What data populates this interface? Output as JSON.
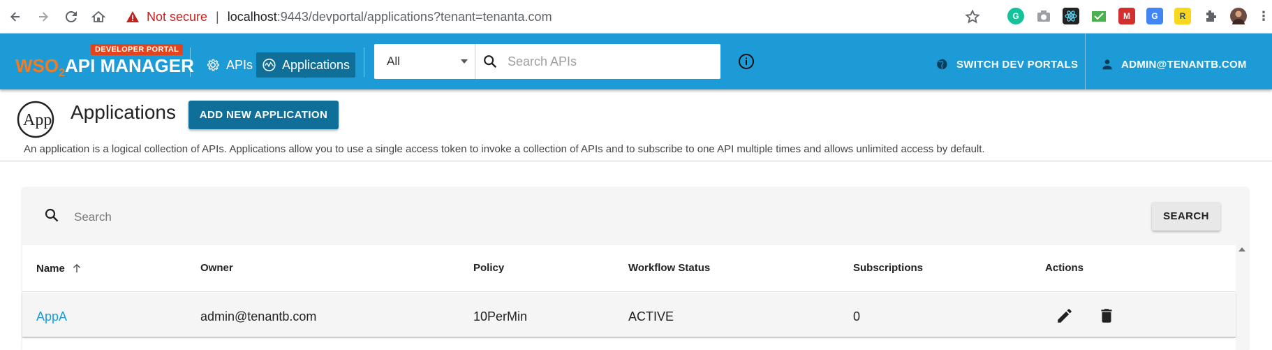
{
  "browser": {
    "security_label": "Not secure",
    "url_host": "localhost",
    "url_rest": ":9443/devportal/applications?tenant=tenanta.com"
  },
  "header": {
    "badge": "DEVELOPER PORTAL",
    "logo_wso": "WSO",
    "logo_sub": "2",
    "product": "API MANAGER",
    "nav": [
      {
        "label": "APIs",
        "icon": "gear-icon"
      },
      {
        "label": "Applications",
        "icon": "applications-icon",
        "active": true
      }
    ],
    "search": {
      "scope": "All",
      "placeholder": "Search APIs"
    },
    "switch_portals": "SWITCH DEV PORTALS",
    "user": "ADMIN@TENANTB.COM"
  },
  "page": {
    "logo_text": "App",
    "title": "Applications",
    "add_button": "ADD NEW APPLICATION",
    "description": "An application is a logical collection of APIs. Applications allow you to use a single access token to invoke a collection of APIs and to subscribe to one API multiple times and allows unlimited access by default."
  },
  "panel": {
    "search_placeholder": "Search",
    "search_button": "SEARCH"
  },
  "table": {
    "columns": [
      "Name",
      "Owner",
      "Policy",
      "Workflow Status",
      "Subscriptions",
      "Actions"
    ],
    "sort": {
      "column": "Name",
      "direction": "ascending"
    },
    "rows": [
      {
        "name": "AppA",
        "owner": "admin@tenantb.com",
        "policy": "10PerMin",
        "workflow_status": "ACTIVE",
        "subscriptions": "0"
      }
    ]
  },
  "colors": {
    "header_bg": "#1d9bd7",
    "active_nav_bg": "#0f6f99",
    "primary_button": "#0f6f99",
    "badge_bg": "#e4441b",
    "link": "#1d9bd7"
  }
}
